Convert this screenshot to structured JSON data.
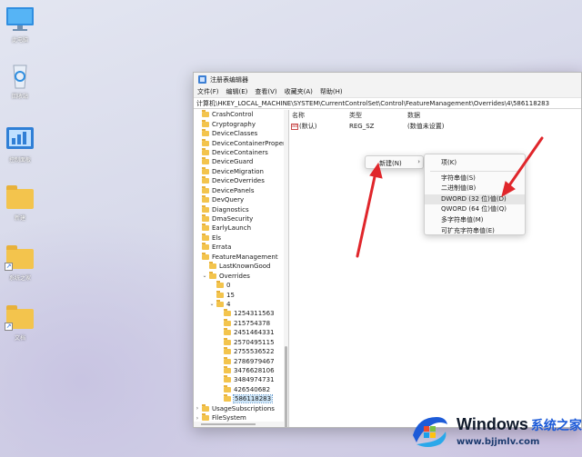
{
  "desktop": {
    "icons": [
      {
        "label": "此电脑",
        "icon": "monitor-icon"
      },
      {
        "label": "回收站",
        "icon": "recycle-bin-icon"
      },
      {
        "label": "控制面板",
        "icon": "control-panel-icon"
      },
      {
        "label": "新建",
        "icon": "folder-icon"
      },
      {
        "label": "系统之家",
        "icon": "folder-shortcut-icon"
      },
      {
        "label": "文档",
        "icon": "folder-shortcut-icon"
      }
    ]
  },
  "window": {
    "title": "注册表编辑器",
    "menu": [
      "文件(F)",
      "编辑(E)",
      "查看(V)",
      "收藏夹(A)",
      "帮助(H)"
    ],
    "address": "计算机\\HKEY_LOCAL_MACHINE\\SYSTEM\\CurrentControlSet\\Control\\FeatureManagement\\Overrides\\4\\586118283",
    "tree": [
      {
        "label": "CrashControl",
        "indent": 0,
        "chev": ""
      },
      {
        "label": "Cryptography",
        "indent": 0,
        "chev": ""
      },
      {
        "label": "DeviceClasses",
        "indent": 0,
        "chev": ""
      },
      {
        "label": "DeviceContainerPropertyUpda",
        "indent": 0,
        "chev": ""
      },
      {
        "label": "DeviceContainers",
        "indent": 0,
        "chev": ""
      },
      {
        "label": "DeviceGuard",
        "indent": 0,
        "chev": ""
      },
      {
        "label": "DeviceMigration",
        "indent": 0,
        "chev": ""
      },
      {
        "label": "DeviceOverrides",
        "indent": 0,
        "chev": ""
      },
      {
        "label": "DevicePanels",
        "indent": 0,
        "chev": ""
      },
      {
        "label": "DevQuery",
        "indent": 0,
        "chev": ""
      },
      {
        "label": "Diagnostics",
        "indent": 0,
        "chev": ""
      },
      {
        "label": "DmaSecurity",
        "indent": 0,
        "chev": ""
      },
      {
        "label": "EarlyLaunch",
        "indent": 0,
        "chev": ""
      },
      {
        "label": "Els",
        "indent": 0,
        "chev": ""
      },
      {
        "label": "Errata",
        "indent": 0,
        "chev": ""
      },
      {
        "label": "FeatureManagement",
        "indent": 0,
        "chev": ""
      },
      {
        "label": "LastKnownGood",
        "indent": 1,
        "chev": ""
      },
      {
        "label": "Overrides",
        "indent": 1,
        "chev": "⌄"
      },
      {
        "label": "0",
        "indent": 2,
        "chev": ""
      },
      {
        "label": "15",
        "indent": 2,
        "chev": ""
      },
      {
        "label": "4",
        "indent": 2,
        "chev": "⌄"
      },
      {
        "label": "1254311563",
        "indent": 3,
        "chev": ""
      },
      {
        "label": "215754378",
        "indent": 3,
        "chev": ""
      },
      {
        "label": "2451464331",
        "indent": 3,
        "chev": ""
      },
      {
        "label": "2570495115",
        "indent": 3,
        "chev": ""
      },
      {
        "label": "2755536522",
        "indent": 3,
        "chev": ""
      },
      {
        "label": "2786979467",
        "indent": 3,
        "chev": ""
      },
      {
        "label": "3476628106",
        "indent": 3,
        "chev": ""
      },
      {
        "label": "3484974731",
        "indent": 3,
        "chev": ""
      },
      {
        "label": "426540682",
        "indent": 3,
        "chev": ""
      },
      {
        "label": "586118283",
        "indent": 3,
        "chev": "",
        "selected": true
      },
      {
        "label": "UsageSubscriptions",
        "indent": 0,
        "chev": "›"
      },
      {
        "label": "FileSystem",
        "indent": 0,
        "chev": "›"
      }
    ],
    "columns": {
      "name": "名称",
      "type": "类型",
      "data": "数据"
    },
    "values": [
      {
        "name": "(默认)",
        "type": "REG_SZ",
        "data": "(数值未设置)"
      }
    ]
  },
  "context_menu": {
    "item": "新建(N)",
    "arrow": "›"
  },
  "submenu": {
    "items": [
      "项(K)",
      "字符串值(S)",
      "二进制值(B)",
      "DWORD (32 位)值(D)",
      "QWORD (64 位)值(Q)",
      "多字符串值(M)",
      "可扩充字符串值(E)"
    ],
    "highlighted": 3
  },
  "watermark": {
    "brand": "Windows",
    "brand_cn": "系统之家",
    "url": "www.bjjmlv.com"
  },
  "colors": {
    "folder": "#f3c44d",
    "selection": "#cce4f7",
    "annotation_arrow": "#e0262b",
    "watermark_blue": "#1d5bd8"
  }
}
